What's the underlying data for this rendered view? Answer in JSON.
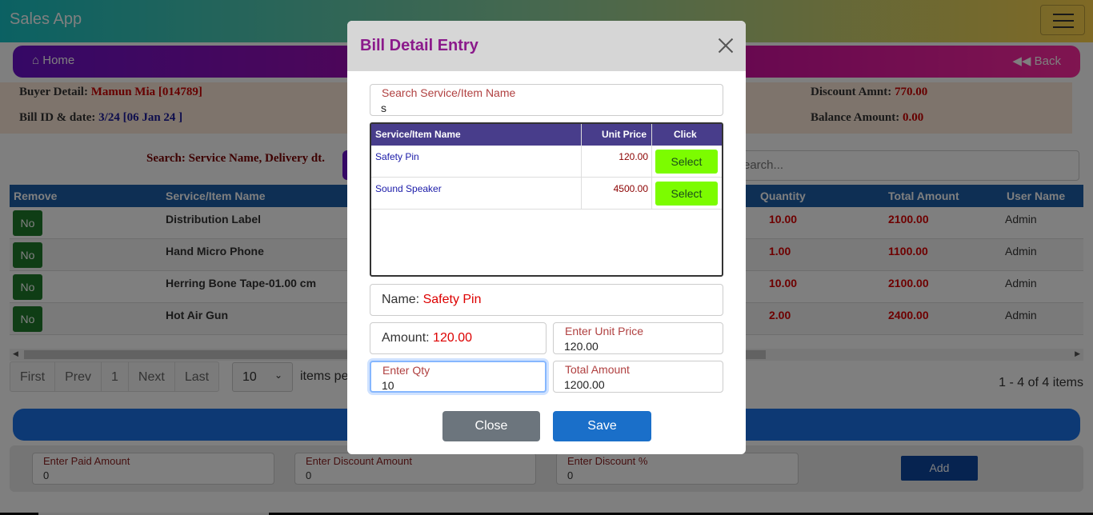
{
  "app": {
    "title": "Sales App"
  },
  "nav": {
    "home_label": "Home",
    "back_label": "Back"
  },
  "info": {
    "buyer_label": "Buyer Detail:",
    "buyer_value": "Mamun Mia [014789]",
    "bill_label": "Bill ID & date:",
    "bill_value": "3/24 [06 Jan 24 ]",
    "discount_label": "Discount Amnt:",
    "discount_value": "770.00",
    "balance_label": "Balance Amount:",
    "balance_value": "0.00"
  },
  "search": {
    "label": "Search: Service Name, Delivery dt.",
    "placeholder_visible": "earch..."
  },
  "grid": {
    "headers": {
      "remove": "Remove",
      "name": "Service/Item Name",
      "quantity": "Quantity",
      "total": "Total Amount",
      "user": "User Name"
    },
    "rows": [
      {
        "remove": "No",
        "name": "Distribution Label",
        "qty": "10.00",
        "total": "2100.00",
        "user": "Admin"
      },
      {
        "remove": "No",
        "name": "Hand Micro Phone",
        "qty": "1.00",
        "total": "1100.00",
        "user": "Admin"
      },
      {
        "remove": "No",
        "name": "Herring Bone Tape-01.00 cm",
        "qty": "10.00",
        "total": "2100.00",
        "user": "Admin"
      },
      {
        "remove": "No",
        "name": "Hot Air Gun",
        "qty": "2.00",
        "total": "2400.00",
        "user": "Admin"
      }
    ]
  },
  "pager": {
    "first": "First",
    "prev": "Prev",
    "page": "1",
    "next": "Next",
    "last": "Last",
    "page_size": "10",
    "items_per": "items pe",
    "count": "1 - 4 of 4 items"
  },
  "payment": {
    "paid_label": "Enter Paid Amount",
    "paid_value": "0",
    "discount_label": "Enter Discount Amount",
    "discount_value": "0",
    "percent_label": "Enter Discount %",
    "percent_value": "0",
    "add_label": "Add"
  },
  "modal": {
    "title": "Bill Detail Entry",
    "search_label": "Search Service/Item Name",
    "search_value": "s",
    "table_headers": {
      "name": "Service/Item Name",
      "price": "Unit Price",
      "click": "Click"
    },
    "items": [
      {
        "name": "Safety Pin",
        "price": "120.00",
        "action": "Select"
      },
      {
        "name": "Sound Speaker",
        "price": "4500.00",
        "action": "Select"
      }
    ],
    "name_label": "Name:",
    "name_value": "Safety Pin",
    "amount_label": "Amount:",
    "amount_value": "120.00",
    "unit_price_label": "Enter Unit Price",
    "unit_price_value": "120.00",
    "qty_label": "Enter Qty",
    "qty_value": "10",
    "total_label": "Total Amount",
    "total_value": "1200.00",
    "close_label": "Close",
    "save_label": "Save"
  },
  "colors": {
    "title_purple": "#8b1a8b",
    "grid_header": "#1d5ea8",
    "select_green": "#7cfc00",
    "remove_green": "#1f7a2a",
    "save_blue": "#1a6fc9",
    "close_gray": "#6c757d"
  }
}
